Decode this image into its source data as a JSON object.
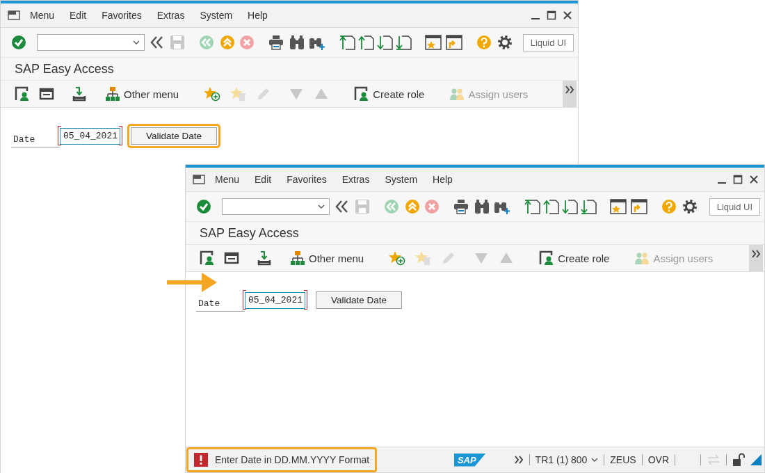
{
  "windows": [
    {
      "menu": [
        "Menu",
        "Edit",
        "Favorites",
        "Extras",
        "System",
        "Help"
      ],
      "liquid_ui": "Liquid UI",
      "title": "SAP Easy Access",
      "app_toolbar": [
        {
          "label": "Other menu",
          "disabled": false
        },
        {
          "label": "Create role",
          "disabled": false
        },
        {
          "label": "Assign users",
          "disabled": true
        }
      ],
      "form": {
        "label": "Date",
        "value": "05_04_2021",
        "button": "Validate Date",
        "button_highlighted": true
      }
    },
    {
      "menu": [
        "Menu",
        "Edit",
        "Favorites",
        "Extras",
        "System",
        "Help"
      ],
      "liquid_ui": "Liquid UI",
      "title": "SAP Easy Access",
      "app_toolbar": [
        {
          "label": "Other menu",
          "disabled": false
        },
        {
          "label": "Create role",
          "disabled": false
        },
        {
          "label": "Assign users",
          "disabled": true
        }
      ],
      "form": {
        "label": "Date",
        "value": "05_04_2021",
        "button": "Validate Date",
        "button_highlighted": false
      },
      "pointer_arrow": true,
      "status_bar": {
        "message": "Enter Date in DD.MM.YYYY Format",
        "kind": "error",
        "highlighted": true,
        "logo": "SAP",
        "system": "TR1 (1) 800",
        "server": "ZEUS",
        "mode": "OVR"
      }
    }
  ]
}
